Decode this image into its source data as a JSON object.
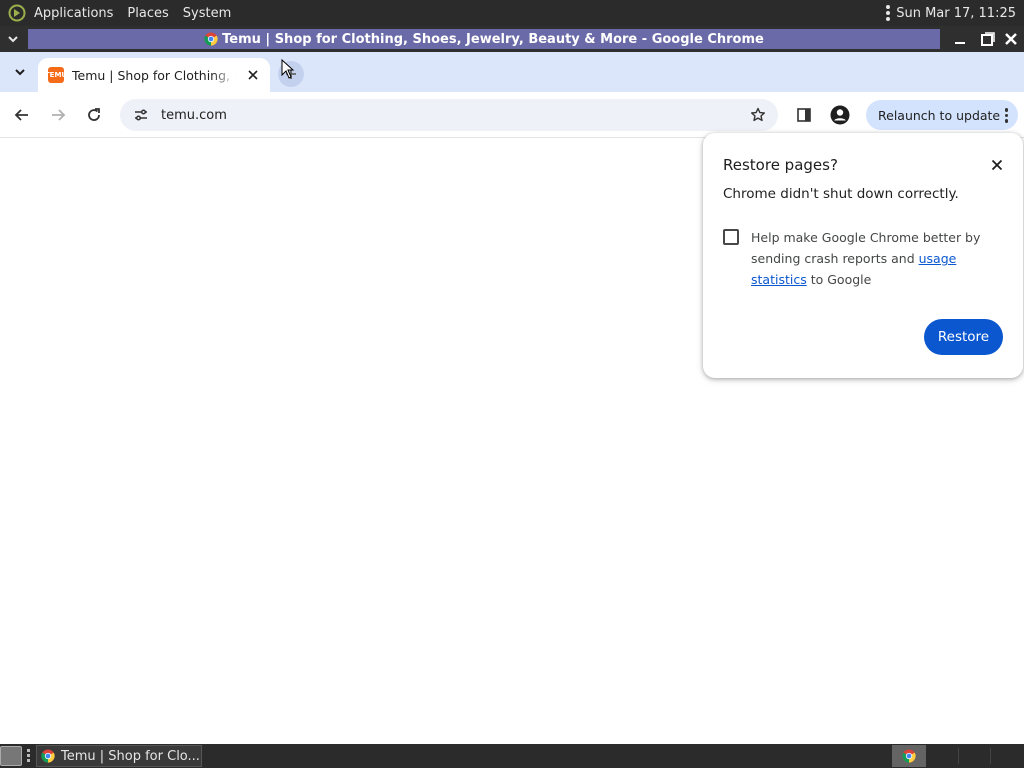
{
  "top_panel": {
    "menus": [
      "Applications",
      "Places",
      "System"
    ],
    "clock": "Sun Mar 17, 11:25"
  },
  "window": {
    "title": "Temu | Shop for Clothing, Shoes, Jewelry, Beauty & More - Google Chrome"
  },
  "tabs": [
    {
      "title": "Temu | Shop for Clothing, Shoes, Jewelry, Beauty & More",
      "favicon": "temu-favicon",
      "active": true
    }
  ],
  "toolbar": {
    "url": "temu.com",
    "relaunch_label": "Relaunch to update"
  },
  "restore_dialog": {
    "title": "Restore pages?",
    "message": "Chrome didn't shut down correctly.",
    "checkbox_text_before": "Help make Google Chrome better by sending crash reports and ",
    "checkbox_link": "usage statistics",
    "checkbox_text_after": " to Google",
    "checkbox_checked": false,
    "restore_label": "Restore"
  },
  "taskbar": {
    "task_label": "Temu | Shop for Clo..."
  },
  "colors": {
    "accent": "#0b57d0",
    "tabstrip": "#dbe6fb",
    "title_highlight": "#6a6aa8",
    "temu_orange": "#f66b1a"
  }
}
